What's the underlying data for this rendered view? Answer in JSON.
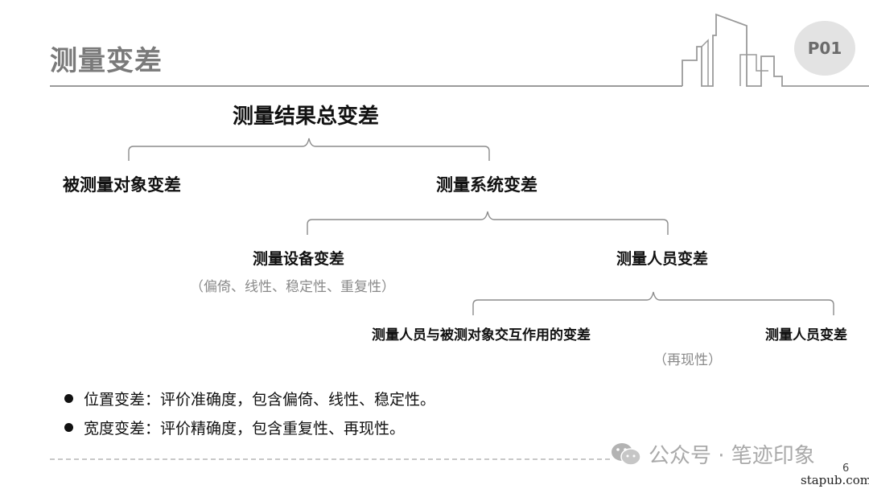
{
  "slide": {
    "title": "测量变差",
    "page_badge": "P01",
    "page_number": "6"
  },
  "tree": {
    "root": "测量结果总变差",
    "level1": {
      "left": "被测量对象变差",
      "right": "测量系统变差"
    },
    "level2": {
      "equipment": "测量设备变差",
      "equipment_note": "（偏倚、线性、稳定性、重复性）",
      "personnel": "测量人员变差"
    },
    "level3": {
      "interaction": "测量人员与被测对象交互作用的变差",
      "personnel": "测量人员变差",
      "note": "（再现性）"
    }
  },
  "bullets": [
    "位置变差：评价准确度，包含偏倚、线性、稳定性。",
    "宽度变差：评价精确度，包含重复性、再现性。"
  ],
  "watermark": {
    "text": "公众号 · 笔迹印象",
    "site": "stapub.com"
  },
  "colors": {
    "title_gray": "#7a7a7a",
    "line_gray": "#8c8c8c",
    "badge_bg": "#e3e3e3"
  }
}
